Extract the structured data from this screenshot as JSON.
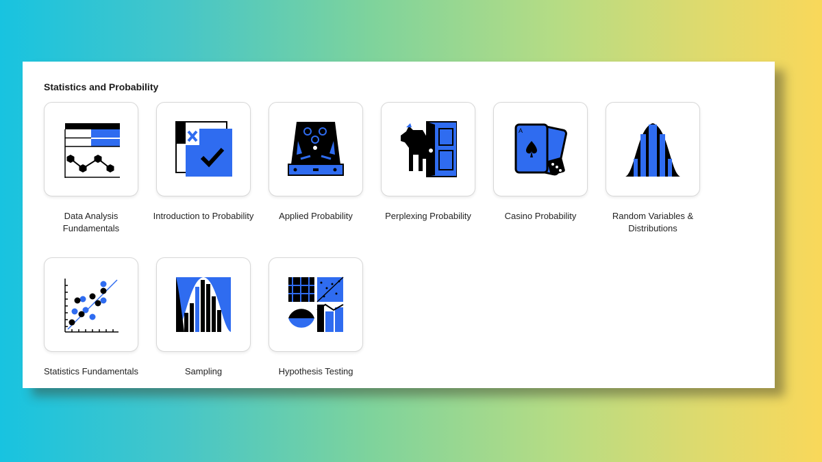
{
  "section": {
    "title": "Statistics and Probability"
  },
  "courses": [
    {
      "label": "Data Analysis Fundamentals",
      "icon": "table-line-chart-icon"
    },
    {
      "label": "Introduction to Probability",
      "icon": "checkbox-x-check-icon"
    },
    {
      "label": "Applied Probability",
      "icon": "pinball-machine-icon"
    },
    {
      "label": "Perplexing Probability",
      "icon": "goat-door-icon"
    },
    {
      "label": "Casino Probability",
      "icon": "cards-dice-icon"
    },
    {
      "label": "Random Variables & Distributions",
      "icon": "bell-curve-bars-icon"
    },
    {
      "label": "Statistics Fundamentals",
      "icon": "scatter-plot-icon"
    },
    {
      "label": "Sampling",
      "icon": "histogram-curve-icon"
    },
    {
      "label": "Hypothesis Testing",
      "icon": "hypothesis-collage-icon"
    }
  ],
  "colors": {
    "accent": "#2f6cf0",
    "ink": "#000000",
    "background_left": "#18c3e0",
    "background_right": "#f9d85a"
  }
}
